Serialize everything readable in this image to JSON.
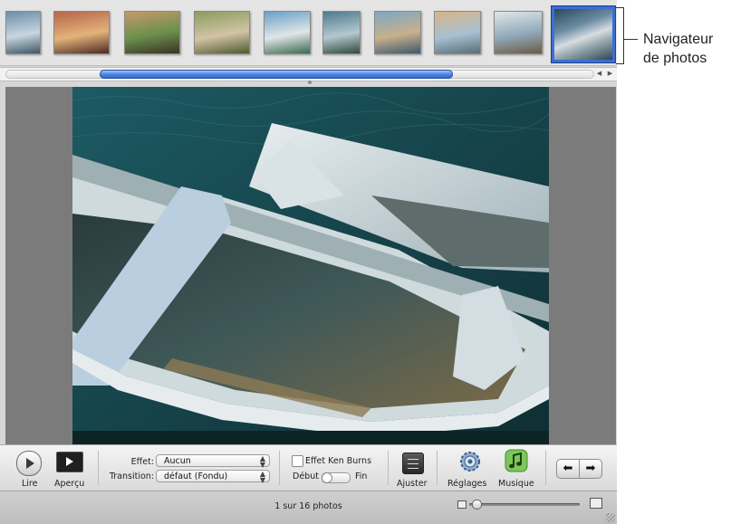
{
  "callout": {
    "line1": "Navigateur",
    "line2": "de photos"
  },
  "filmstrip": {
    "thumbnails": [
      {
        "name": "thumb-1",
        "colors": [
          "#6b8ea8",
          "#c8d6e0",
          "#3e5566"
        ]
      },
      {
        "name": "thumb-2",
        "colors": [
          "#b5654a",
          "#e4b27a",
          "#4a2a22"
        ]
      },
      {
        "name": "thumb-3",
        "colors": [
          "#c49a6a",
          "#6a8f4c",
          "#3b3324"
        ]
      },
      {
        "name": "thumb-4",
        "colors": [
          "#8a9c60",
          "#d2c3a4",
          "#4d5a2e"
        ]
      },
      {
        "name": "thumb-5",
        "colors": [
          "#6aa0c7",
          "#e0e6e8",
          "#3b6a4f"
        ]
      },
      {
        "name": "thumb-6",
        "colors": [
          "#4f7a8f",
          "#b4c8cf",
          "#2e4a3b"
        ]
      },
      {
        "name": "thumb-7",
        "colors": [
          "#7fa7c4",
          "#c7b08a",
          "#3c5a6e"
        ]
      },
      {
        "name": "thumb-8",
        "colors": [
          "#d6b48a",
          "#a7c0d1",
          "#5b6d74"
        ]
      },
      {
        "name": "thumb-9",
        "colors": [
          "#e3e6e8",
          "#8fa9b8",
          "#6c5a44"
        ]
      },
      {
        "name": "thumb-10",
        "colors": [
          "#294a5c",
          "#d7dde0",
          "#2c4754"
        ],
        "selected": true
      }
    ],
    "scroll_position": 0.4
  },
  "toolbar": {
    "play_label": "Lire",
    "preview_label": "Aperçu",
    "effect_label": "Effet:",
    "effect_value": "Aucun",
    "transition_label": "Transition:",
    "transition_value": "défaut (Fondu)",
    "kenburns_label": "Effet Ken Burns",
    "start_label": "Début",
    "end_label": "Fin",
    "adjust_label": "Ajuster",
    "settings_label": "Réglages",
    "music_label": "Musique"
  },
  "status": {
    "photo_count": "1 sur 16 photos",
    "zoom_level": 0.03
  }
}
